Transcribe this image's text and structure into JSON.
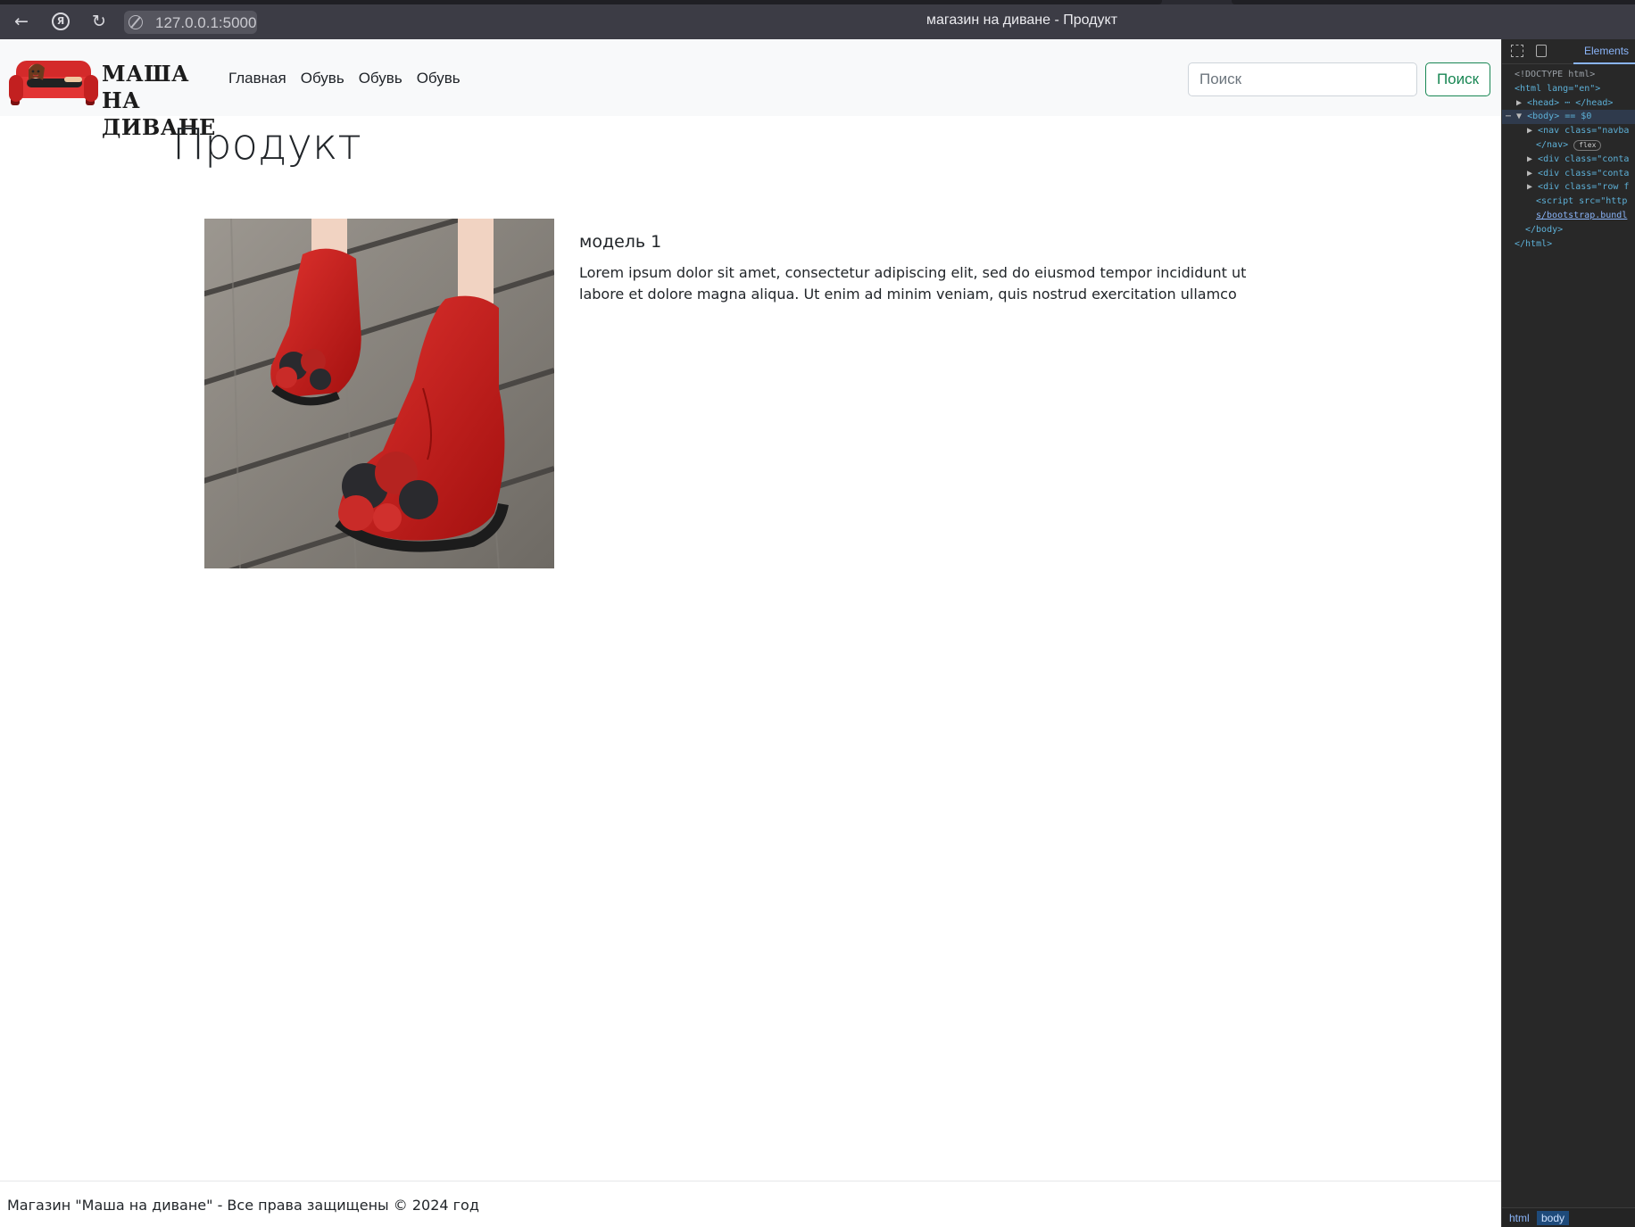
{
  "browser": {
    "url": "127.0.0.1:5000",
    "window_title": "магазин на диване - Продукт",
    "icons": [
      "back-arrow-icon",
      "yandex-logo-icon",
      "reload-icon",
      "site-info-icon"
    ]
  },
  "navbar": {
    "logo_text_line1": "МАША НА",
    "logo_text_line2": "ДИВАНЕ",
    "links": [
      "Главная",
      "Обувь",
      "Обувь",
      "Обувь"
    ],
    "search_placeholder": "Поиск",
    "search_button": "Поиск"
  },
  "page": {
    "title": "Продукт"
  },
  "product": {
    "name": "модель 1",
    "description": "Lorem ipsum dolor sit amet, consectetur adipiscing elit, sed do eiusmod tempor incididunt ut labore et dolore magna aliqua. Ut enim ad minim veniam, quis nostrud exercitation ullamco"
  },
  "footer": {
    "text": "Магазин \"Маша на диване\" - Все права защищены © 2024 год"
  },
  "devtools": {
    "tab": "Elements",
    "tree": {
      "doctype": "<!DOCTYPE html>",
      "html_open": "<html lang=\"en\">",
      "head": "<head> ⋯ </head>",
      "body": "<body> == $0",
      "nav": "<nav class=\"navba",
      "nav_close": "</nav>",
      "nav_badge": "flex",
      "div1": "<div class=\"conta",
      "div2": "<div class=\"conta",
      "div3": "<div class=\"row f",
      "script": "<script src=\"http",
      "script_cont": "s/bootstrap.bundl",
      "body_close": "</body>",
      "html_close": "</html>"
    },
    "breadcrumbs": [
      "html",
      "body"
    ]
  },
  "colors": {
    "accent_green": "#198754",
    "navbar_bg": "#f8f9fa",
    "chrome_bg": "#3c3c45",
    "devtools_bg": "#282828"
  }
}
